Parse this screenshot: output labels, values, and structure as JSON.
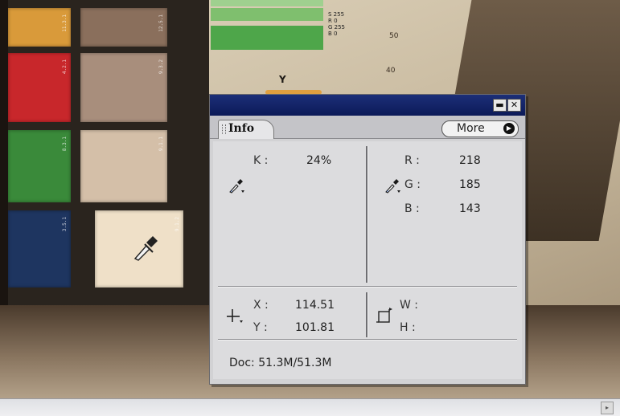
{
  "palette": {
    "tab_label": "Info",
    "more_label": "More",
    "icons": {
      "minimize": "minimize-icon",
      "close": "close-icon",
      "eyedropper": "eyedropper-icon",
      "crosshair": "crosshair-icon",
      "selection": "selection-rect-icon",
      "more_arrow": "play-arrow-icon"
    },
    "readout_left": {
      "k_label": "K :",
      "k_value": "24%"
    },
    "readout_right": {
      "r_label": "R :",
      "r_value": "218",
      "g_label": "G :",
      "g_value": "185",
      "b_label": "B :",
      "b_value": "143"
    },
    "position": {
      "x_label": "X :",
      "x_value": "114.51",
      "y_label": "Y :",
      "y_value": "101.81"
    },
    "size": {
      "w_label": "W :",
      "h_label": "H :"
    },
    "doc_status": "Doc: 51.3M/51.3M",
    "colors": {
      "titlebar": "#0c1a58",
      "panel": "#d2d2d4"
    }
  },
  "scene": {
    "sheet_text_lines": [
      "S 255",
      "R 0",
      "G 255",
      "B 0"
    ],
    "ruler_numbers": [
      "50",
      "40"
    ],
    "axis_letter": "Y",
    "swatch_colors": [
      "#d99a3a",
      "#8a6f5c",
      "#c8272b",
      "#a88e7c",
      "#3a8a3a",
      "#d4bfa8",
      "#1e3560",
      "#efe0c8"
    ]
  }
}
